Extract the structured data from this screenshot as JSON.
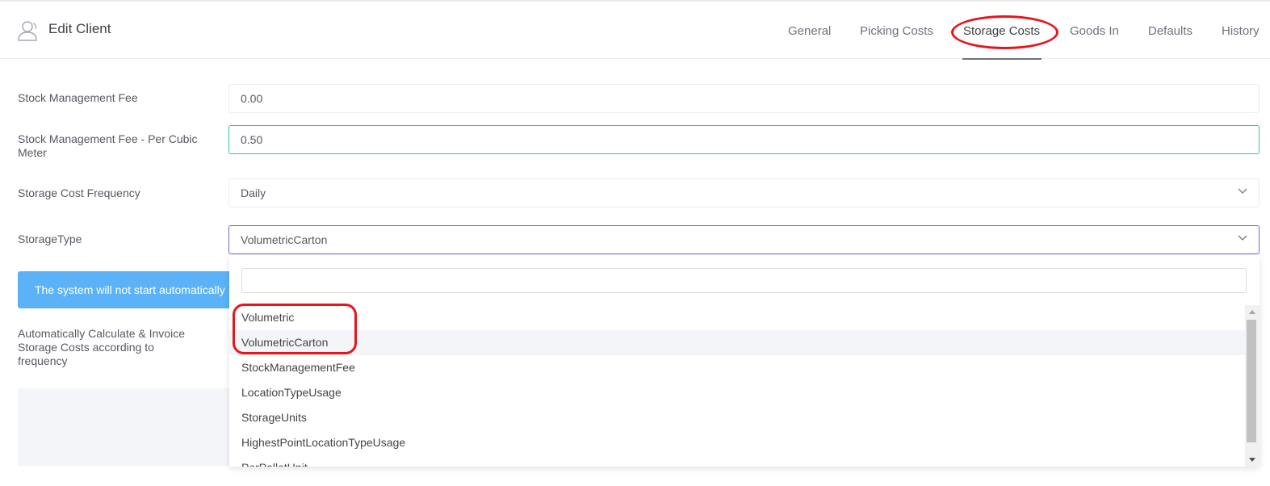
{
  "header": {
    "title": "Edit Client",
    "tabs": [
      {
        "label": "General"
      },
      {
        "label": "Picking Costs"
      },
      {
        "label": "Storage Costs"
      },
      {
        "label": "Goods In"
      },
      {
        "label": "Defaults"
      },
      {
        "label": "History"
      }
    ],
    "active_tab": "Storage Costs"
  },
  "form": {
    "stock_fee": {
      "label": "Stock Management Fee",
      "value": "0.00"
    },
    "stock_fee_cubic": {
      "label": "Stock Management Fee - Per Cubic Meter",
      "value": "0.50"
    },
    "frequency": {
      "label": "Storage Cost Frequency",
      "value": "Daily"
    },
    "storage_type": {
      "label": "StorageType",
      "value": "VolumetricCarton"
    },
    "info_banner": "The system will not start automatically",
    "auto_calc_label": "Automatically Calculate & Invoice Storage Costs according to frequency"
  },
  "dropdown": {
    "search_value": "",
    "options": [
      "Volumetric",
      "VolumetricCarton",
      "StockManagementFee",
      "LocationTypeUsage",
      "StorageUnits",
      "HighestPointLocationTypeUsage",
      "PerPalletUnit"
    ],
    "highlighted": "VolumetricCarton"
  },
  "icons": {
    "user": "user-outline-icon",
    "chevron": "chevron-down-icon",
    "scroll_up": "scroll-up-arrow-icon",
    "scroll_down": "scroll-down-arrow-icon"
  },
  "colors": {
    "annotation": "#e8141c",
    "info_banner": "#5bb2f7",
    "focus_green": "#34bfa3",
    "focus_purple": "#716aca"
  }
}
